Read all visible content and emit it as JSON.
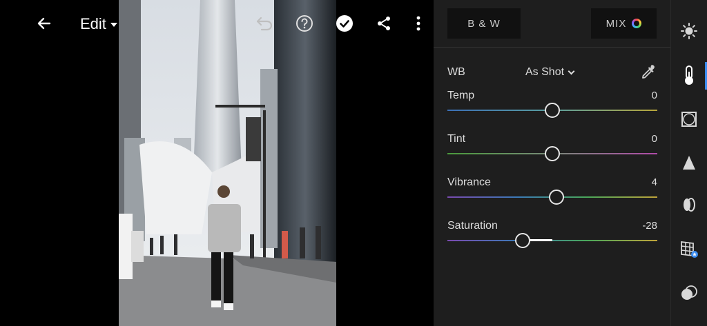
{
  "topbar": {
    "edit_label": "Edit"
  },
  "panel": {
    "bw_label": "B & W",
    "mix_label": "MIX",
    "wb": {
      "label": "WB",
      "value": "As Shot"
    },
    "sliders": [
      {
        "label": "Temp",
        "value": "0",
        "position": 0.5
      },
      {
        "label": "Tint",
        "value": "0",
        "position": 0.5
      },
      {
        "label": "Vibrance",
        "value": "4",
        "position": 0.52
      },
      {
        "label": "Saturation",
        "value": "-28",
        "position": 0.36
      }
    ]
  },
  "colors": {
    "panel_bg": "#1e1e1e",
    "accent": "#3b8cf0"
  },
  "icons": {
    "topbar": [
      "back-arrow-icon",
      "undo-icon",
      "help-icon",
      "done-check-icon",
      "share-icon",
      "more-vert-icon"
    ],
    "toolbar": [
      "light-icon",
      "color-icon",
      "effects-icon",
      "detail-icon",
      "optics-icon",
      "geometry-icon",
      "presets-icon"
    ]
  }
}
